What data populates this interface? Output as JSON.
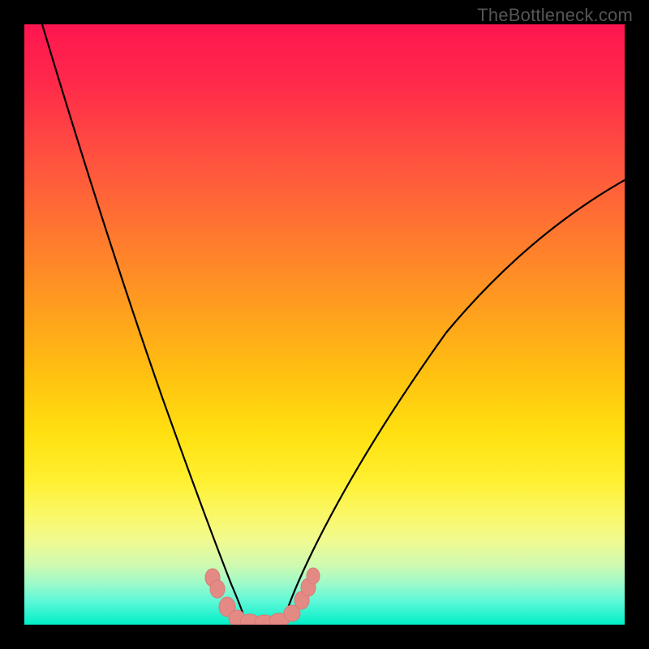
{
  "watermark": "TheBottleneck.com",
  "chart_data": {
    "type": "line",
    "title": "",
    "xlabel": "",
    "ylabel": "",
    "xlim": [
      0,
      100
    ],
    "ylim": [
      0,
      100
    ],
    "gradient_colors": {
      "top": "#ff1550",
      "mid_upper": "#ff9a20",
      "mid": "#ffe010",
      "mid_lower": "#faf86a",
      "bottom": "#00efc8"
    },
    "series": [
      {
        "name": "left-curve",
        "color": "#000000",
        "x": [
          3,
          8,
          13,
          18,
          22,
          26,
          29,
          32,
          34,
          36,
          37
        ],
        "y": [
          100,
          85,
          70,
          55,
          42,
          30,
          20,
          12,
          6,
          2,
          0
        ]
      },
      {
        "name": "right-curve",
        "color": "#000000",
        "x": [
          43,
          45,
          48,
          52,
          58,
          66,
          76,
          88,
          100
        ],
        "y": [
          0,
          3,
          8,
          15,
          25,
          38,
          52,
          65,
          74
        ]
      },
      {
        "name": "bottom-markers",
        "color": "#e48a85",
        "type": "scatter",
        "x": [
          31,
          33,
          35,
          37,
          39,
          41,
          43,
          45,
          47
        ],
        "y": [
          8,
          4,
          1,
          0,
          0,
          0,
          1,
          4,
          8
        ]
      }
    ],
    "annotations": []
  }
}
